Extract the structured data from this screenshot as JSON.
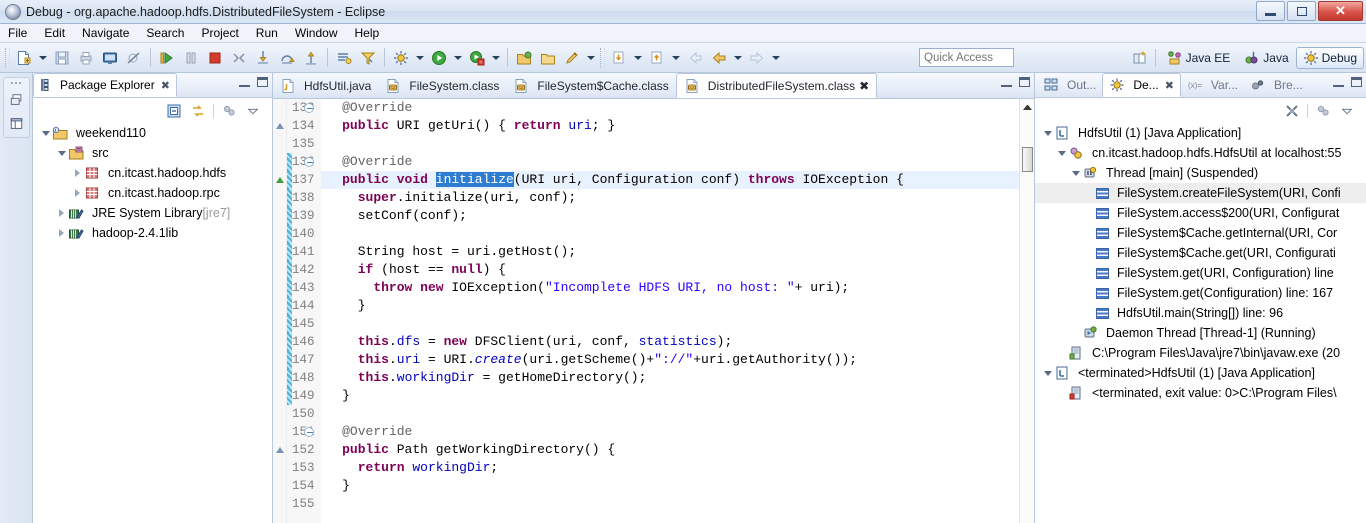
{
  "window": {
    "title": "Debug - org.apache.hadoop.hdfs.DistributedFileSystem - Eclipse",
    "app_icon": "eclipse-icon",
    "controls": {
      "minimize": "minimize-button",
      "restore": "restore-button",
      "close": "✕"
    }
  },
  "menubar": {
    "items": [
      {
        "label": "File"
      },
      {
        "label": "Edit"
      },
      {
        "label": "Navigate"
      },
      {
        "label": "Search"
      },
      {
        "label": "Project"
      },
      {
        "label": "Run"
      },
      {
        "label": "Window"
      },
      {
        "label": "Help"
      }
    ]
  },
  "toolbar": {
    "quick_access_placeholder": "Quick Access",
    "perspectives": [
      {
        "label": "Java EE",
        "active": false
      },
      {
        "label": "Java",
        "active": false
      },
      {
        "label": "Debug",
        "active": true
      }
    ]
  },
  "package_explorer": {
    "tab_label": "Package Explorer",
    "close_glyph": "✖",
    "tree": [
      {
        "label": "weekend110",
        "indent": 0,
        "twisty": "expanded",
        "icon": "java-project-icon"
      },
      {
        "label": "src",
        "indent": 1,
        "twisty": "expanded",
        "icon": "source-folder-icon"
      },
      {
        "label": "cn.itcast.hadoop.hdfs",
        "indent": 2,
        "twisty": "collapsed",
        "icon": "package-icon"
      },
      {
        "label": "cn.itcast.hadoop.rpc",
        "indent": 2,
        "twisty": "collapsed",
        "icon": "package-icon"
      },
      {
        "label": "JRE System Library",
        "suffix": " [jre7]",
        "indent": 1,
        "twisty": "collapsed",
        "icon": "library-icon"
      },
      {
        "label": "hadoop-2.4.1lib",
        "indent": 1,
        "twisty": "collapsed",
        "icon": "library-icon"
      }
    ]
  },
  "editor": {
    "tabs": [
      {
        "label": "HdfsUtil.java",
        "icon": "java-file-icon",
        "active": false
      },
      {
        "label": "FileSystem.class",
        "icon": "class-file-icon",
        "active": false
      },
      {
        "label": "FileSystem$Cache.class",
        "icon": "class-file-icon",
        "active": false
      },
      {
        "label": "DistributedFileSystem.class",
        "icon": "class-file-icon",
        "active": true,
        "close_glyph": "✖"
      }
    ],
    "first_line": 133,
    "lines": [
      {
        "n": 133,
        "fold": true,
        "marker": "",
        "changed": false,
        "current": false,
        "tokens": [
          {
            "t": "  ",
            "c": ""
          },
          {
            "t": "@Override",
            "c": "ann"
          }
        ]
      },
      {
        "n": 134,
        "fold": false,
        "marker": "hollow",
        "changed": false,
        "current": false,
        "tokens": [
          {
            "t": "  ",
            "c": ""
          },
          {
            "t": "public",
            "c": "kw"
          },
          {
            "t": " URI getUri() { ",
            "c": ""
          },
          {
            "t": "return",
            "c": "kw"
          },
          {
            "t": " ",
            "c": ""
          },
          {
            "t": "uri",
            "c": "fld"
          },
          {
            "t": "; }",
            "c": ""
          }
        ]
      },
      {
        "n": 135,
        "fold": false,
        "marker": "",
        "changed": false,
        "current": false,
        "tokens": []
      },
      {
        "n": 136,
        "fold": true,
        "marker": "",
        "changed": true,
        "current": false,
        "tokens": [
          {
            "t": "  ",
            "c": ""
          },
          {
            "t": "@Override",
            "c": "ann"
          }
        ]
      },
      {
        "n": 137,
        "fold": false,
        "marker": "green",
        "changed": true,
        "current": true,
        "tokens": [
          {
            "t": "  ",
            "c": ""
          },
          {
            "t": "public",
            "c": "kw"
          },
          {
            "t": " ",
            "c": ""
          },
          {
            "t": "void",
            "c": "kw"
          },
          {
            "t": " ",
            "c": ""
          },
          {
            "t": "initialize",
            "c": "sel"
          },
          {
            "t": "(URI uri, Configuration conf) ",
            "c": ""
          },
          {
            "t": "throws",
            "c": "kw"
          },
          {
            "t": " IOException {",
            "c": ""
          }
        ]
      },
      {
        "n": 138,
        "fold": false,
        "marker": "",
        "changed": true,
        "current": false,
        "tokens": [
          {
            "t": "    ",
            "c": ""
          },
          {
            "t": "super",
            "c": "kw"
          },
          {
            "t": ".initialize(uri, conf);",
            "c": ""
          }
        ]
      },
      {
        "n": 139,
        "fold": false,
        "marker": "",
        "changed": true,
        "current": false,
        "tokens": [
          {
            "t": "    setConf(conf);",
            "c": ""
          }
        ]
      },
      {
        "n": 140,
        "fold": false,
        "marker": "",
        "changed": true,
        "current": false,
        "tokens": []
      },
      {
        "n": 141,
        "fold": false,
        "marker": "",
        "changed": true,
        "current": false,
        "tokens": [
          {
            "t": "    String host = uri.getHost();",
            "c": ""
          }
        ]
      },
      {
        "n": 142,
        "fold": false,
        "marker": "",
        "changed": true,
        "current": false,
        "tokens": [
          {
            "t": "    ",
            "c": ""
          },
          {
            "t": "if",
            "c": "kw"
          },
          {
            "t": " (host == ",
            "c": ""
          },
          {
            "t": "null",
            "c": "kw"
          },
          {
            "t": ") {",
            "c": ""
          }
        ]
      },
      {
        "n": 143,
        "fold": false,
        "marker": "",
        "changed": true,
        "current": false,
        "tokens": [
          {
            "t": "      ",
            "c": ""
          },
          {
            "t": "throw",
            "c": "kw"
          },
          {
            "t": " ",
            "c": ""
          },
          {
            "t": "new",
            "c": "kw"
          },
          {
            "t": " IOException(",
            "c": ""
          },
          {
            "t": "\"Incomplete HDFS URI, no host: \"",
            "c": "str"
          },
          {
            "t": "+ uri);",
            "c": ""
          }
        ]
      },
      {
        "n": 144,
        "fold": false,
        "marker": "",
        "changed": true,
        "current": false,
        "tokens": [
          {
            "t": "    }",
            "c": ""
          }
        ]
      },
      {
        "n": 145,
        "fold": false,
        "marker": "",
        "changed": true,
        "current": false,
        "tokens": []
      },
      {
        "n": 146,
        "fold": false,
        "marker": "",
        "changed": true,
        "current": false,
        "tokens": [
          {
            "t": "    ",
            "c": ""
          },
          {
            "t": "this",
            "c": "kw"
          },
          {
            "t": ".",
            "c": ""
          },
          {
            "t": "dfs",
            "c": "fld"
          },
          {
            "t": " = ",
            "c": ""
          },
          {
            "t": "new",
            "c": "kw"
          },
          {
            "t": " DFSClient(uri, conf, ",
            "c": ""
          },
          {
            "t": "statistics",
            "c": "fld"
          },
          {
            "t": ");",
            "c": ""
          }
        ]
      },
      {
        "n": 147,
        "fold": false,
        "marker": "",
        "changed": true,
        "current": false,
        "tokens": [
          {
            "t": "    ",
            "c": ""
          },
          {
            "t": "this",
            "c": "kw"
          },
          {
            "t": ".",
            "c": ""
          },
          {
            "t": "uri",
            "c": "fld"
          },
          {
            "t": " = URI.",
            "c": ""
          },
          {
            "t": "create",
            "c": "stat"
          },
          {
            "t": "(uri.getScheme()+",
            "c": ""
          },
          {
            "t": "\"://\"",
            "c": "str"
          },
          {
            "t": "+uri.getAuthority());",
            "c": ""
          }
        ]
      },
      {
        "n": 148,
        "fold": false,
        "marker": "",
        "changed": true,
        "current": false,
        "tokens": [
          {
            "t": "    ",
            "c": ""
          },
          {
            "t": "this",
            "c": "kw"
          },
          {
            "t": ".",
            "c": ""
          },
          {
            "t": "workingDir",
            "c": "fld"
          },
          {
            "t": " = getHomeDirectory();",
            "c": ""
          }
        ]
      },
      {
        "n": 149,
        "fold": false,
        "marker": "",
        "changed": true,
        "current": false,
        "tokens": [
          {
            "t": "  }",
            "c": ""
          }
        ]
      },
      {
        "n": 150,
        "fold": false,
        "marker": "",
        "changed": false,
        "current": false,
        "tokens": []
      },
      {
        "n": 151,
        "fold": true,
        "marker": "",
        "changed": false,
        "current": false,
        "tokens": [
          {
            "t": "  ",
            "c": ""
          },
          {
            "t": "@Override",
            "c": "ann"
          }
        ]
      },
      {
        "n": 152,
        "fold": false,
        "marker": "hollow",
        "changed": false,
        "current": false,
        "tokens": [
          {
            "t": "  ",
            "c": ""
          },
          {
            "t": "public",
            "c": "kw"
          },
          {
            "t": " Path getWorkingDirectory() {",
            "c": ""
          }
        ]
      },
      {
        "n": 153,
        "fold": false,
        "marker": "",
        "changed": false,
        "current": false,
        "tokens": [
          {
            "t": "    ",
            "c": ""
          },
          {
            "t": "return",
            "c": "kw"
          },
          {
            "t": " ",
            "c": ""
          },
          {
            "t": "workingDir",
            "c": "fld"
          },
          {
            "t": ";",
            "c": ""
          }
        ]
      },
      {
        "n": 154,
        "fold": false,
        "marker": "",
        "changed": false,
        "current": false,
        "tokens": [
          {
            "t": "  }",
            "c": ""
          }
        ]
      },
      {
        "n": 155,
        "fold": false,
        "marker": "",
        "changed": false,
        "current": false,
        "tokens": []
      }
    ]
  },
  "debug_view": {
    "tabs": [
      {
        "label": "Out...",
        "icon": "outline-icon",
        "active": false
      },
      {
        "label": "De...",
        "icon": "debug-icon",
        "active": true,
        "close_glyph": "✖"
      },
      {
        "label": "Var...",
        "icon": "variables-icon",
        "active": false
      },
      {
        "label": "Bre...",
        "icon": "breakpoints-icon",
        "active": false
      }
    ],
    "tree": [
      {
        "label": "HdfsUtil (1) [Java Application]",
        "indent": 0,
        "twisty": "expanded",
        "icon": "launch-icon",
        "selected": false
      },
      {
        "label": "cn.itcast.hadoop.hdfs.HdfsUtil at localhost:55",
        "indent": 1,
        "twisty": "expanded",
        "icon": "debug-target-icon",
        "selected": false
      },
      {
        "label": "Thread [main] (Suspended)",
        "indent": 2,
        "twisty": "expanded",
        "icon": "thread-suspended-icon",
        "selected": false
      },
      {
        "label": "FileSystem.createFileSystem(URI, Confi",
        "indent": 3,
        "twisty": "none",
        "icon": "stack-frame-icon",
        "selected": true
      },
      {
        "label": "FileSystem.access$200(URI, Configurat",
        "indent": 3,
        "twisty": "none",
        "icon": "stack-frame-icon",
        "selected": false
      },
      {
        "label": "FileSystem$Cache.getInternal(URI, Cor",
        "indent": 3,
        "twisty": "none",
        "icon": "stack-frame-icon",
        "selected": false
      },
      {
        "label": "FileSystem$Cache.get(URI, Configurati",
        "indent": 3,
        "twisty": "none",
        "icon": "stack-frame-icon",
        "selected": false
      },
      {
        "label": "FileSystem.get(URI, Configuration) line",
        "indent": 3,
        "twisty": "none",
        "icon": "stack-frame-icon",
        "selected": false
      },
      {
        "label": "FileSystem.get(Configuration) line: 167",
        "indent": 3,
        "twisty": "none",
        "icon": "stack-frame-icon",
        "selected": false
      },
      {
        "label": "HdfsUtil.main(String[]) line: 96",
        "indent": 3,
        "twisty": "none",
        "icon": "stack-frame-icon",
        "selected": false
      },
      {
        "label": "Daemon Thread [Thread-1] (Running)",
        "indent": 2,
        "twisty": "none",
        "icon": "thread-running-icon",
        "selected": false
      },
      {
        "label": "C:\\Program Files\\Java\\jre7\\bin\\javaw.exe (20",
        "indent": 1,
        "twisty": "none",
        "icon": "process-icon",
        "selected": false
      },
      {
        "label": "<terminated>HdfsUtil (1) [Java Application]",
        "indent": 0,
        "twisty": "expanded",
        "icon": "launch-icon",
        "selected": false
      },
      {
        "label": "<terminated, exit value: 0>C:\\Program Files\\",
        "indent": 1,
        "twisty": "none",
        "icon": "process-terminated-icon",
        "selected": false
      }
    ]
  }
}
